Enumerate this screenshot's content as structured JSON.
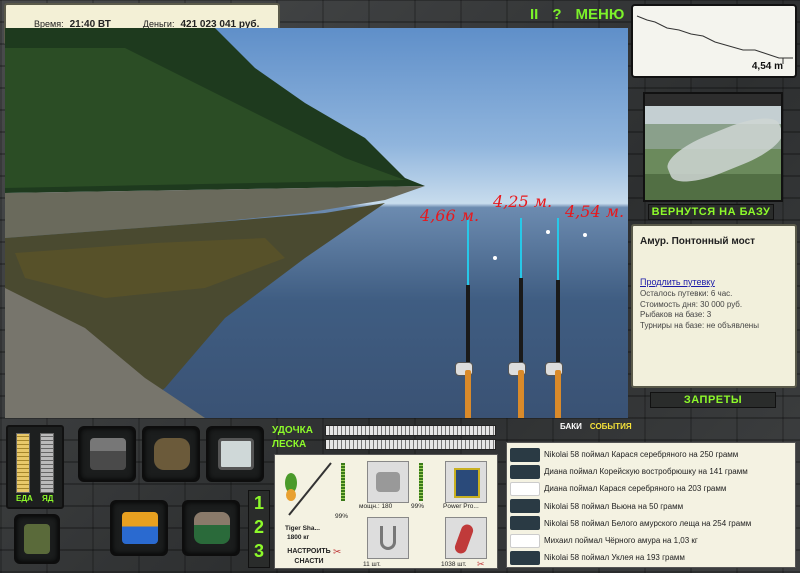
{
  "hud": {
    "time_label": "Время:",
    "time_value": "21:40 ВТ",
    "money_label": "Деньги:",
    "money_value": "421 023 041 руб."
  },
  "top_menu": {
    "pause": "II",
    "help": "?",
    "menu": "МЕНЮ"
  },
  "depth": {
    "value": "4,54 m"
  },
  "rods": [
    {
      "distance": "4,66 м."
    },
    {
      "distance": "4,25 м."
    },
    {
      "distance": "4,54 м."
    }
  ],
  "return_button": "ВЕРНУТСЯ НА БАЗУ",
  "location": {
    "title": "Амур. Понтонный мост",
    "extend_link": "Продлить путевку",
    "lines": [
      "Осталось путевки: 6 час.",
      "Стоимость дня: 30 000 руб.",
      "Рыбаков на базе: 3",
      "Турниры на базе: не объявлены"
    ]
  },
  "bans_button": "ЗАПРЕТЫ",
  "meters": {
    "food_label": "ЕДА",
    "poison_label": "ЯД",
    "food_level": 1.0,
    "poison_level": 0.0
  },
  "rod_numbers": [
    "1",
    "2",
    "3"
  ],
  "rod_line": {
    "rod_label": "УДОЧКА",
    "line_label": "ЛЕСКА"
  },
  "tackle": {
    "rod_name": "Tiger Sha...",
    "rod_weight": "1800 кг",
    "rod_pct": "99%",
    "reel_label": "мощн.: 180",
    "reel_pct": "99%",
    "line_name": "Power Pro...",
    "hook_count": "11 шт.",
    "bait_count": "1038 шт.",
    "configure": "НАСТРОИТЬ СНАСТИ"
  },
  "events_header": {
    "baki": "БАКИ",
    "events": "СОБЫТИЯ"
  },
  "catch_log": [
    {
      "text": "Nikolai 58 поймал Карася серебряного на 250 грамм",
      "fish": "dark"
    },
    {
      "text": "Диана поймал Корейскую востробрюшку на 141 грамм",
      "fish": "dark"
    },
    {
      "text": "Диана поймал Карася серебряного на 203 грамм",
      "fish": "light"
    },
    {
      "text": "Nikolai 58 поймал Вьюна на 50 грамм",
      "fish": "dark"
    },
    {
      "text": "Nikolai 58 поймал Белого амурского леща на 254 грамм",
      "fish": "dark"
    },
    {
      "text": "Михаил поймал Чёрного амура на 1,03 кг",
      "fish": "light"
    },
    {
      "text": "Nikolai 58 поймал Уклея на 193 грамм",
      "fish": "dark"
    }
  ],
  "colors": {
    "accent_green": "#8dfa2a",
    "distance_red": "#e8181c",
    "panel_bg": "#f2f0dc"
  }
}
